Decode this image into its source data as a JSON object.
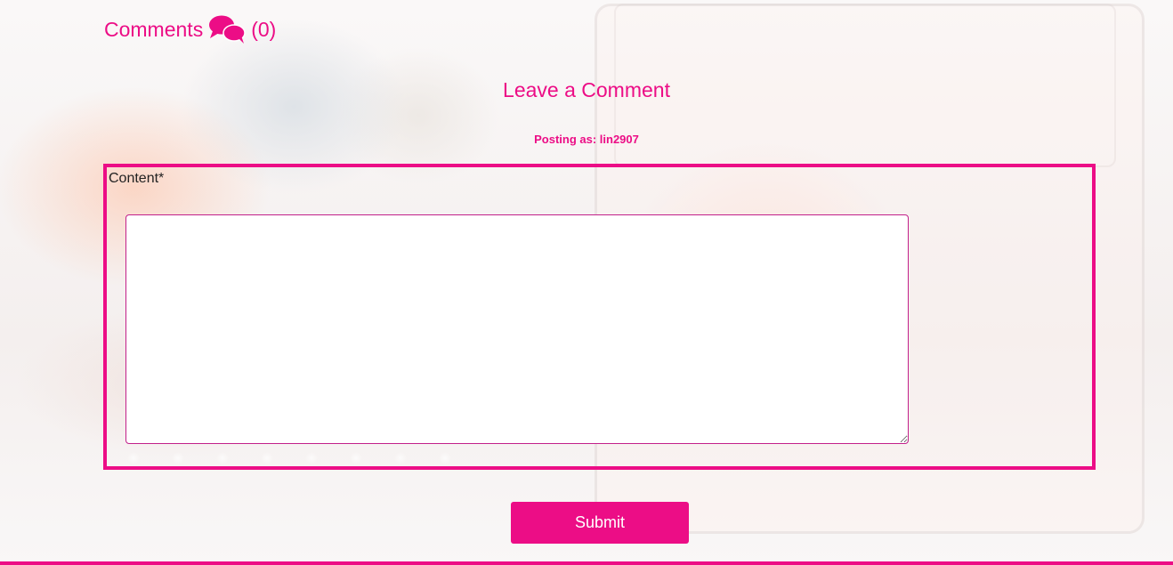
{
  "comments_header": {
    "label": "Comments",
    "icon": "comments-icon",
    "count": "(0)"
  },
  "form": {
    "title": "Leave a Comment",
    "posting_as": "Posting as: lin2907",
    "content_label": "Content*",
    "content_value": "",
    "submit_label": "Submit"
  },
  "colors": {
    "accent": "#ec0d86",
    "label_text": "#222222",
    "button_text": "#ffffff"
  }
}
